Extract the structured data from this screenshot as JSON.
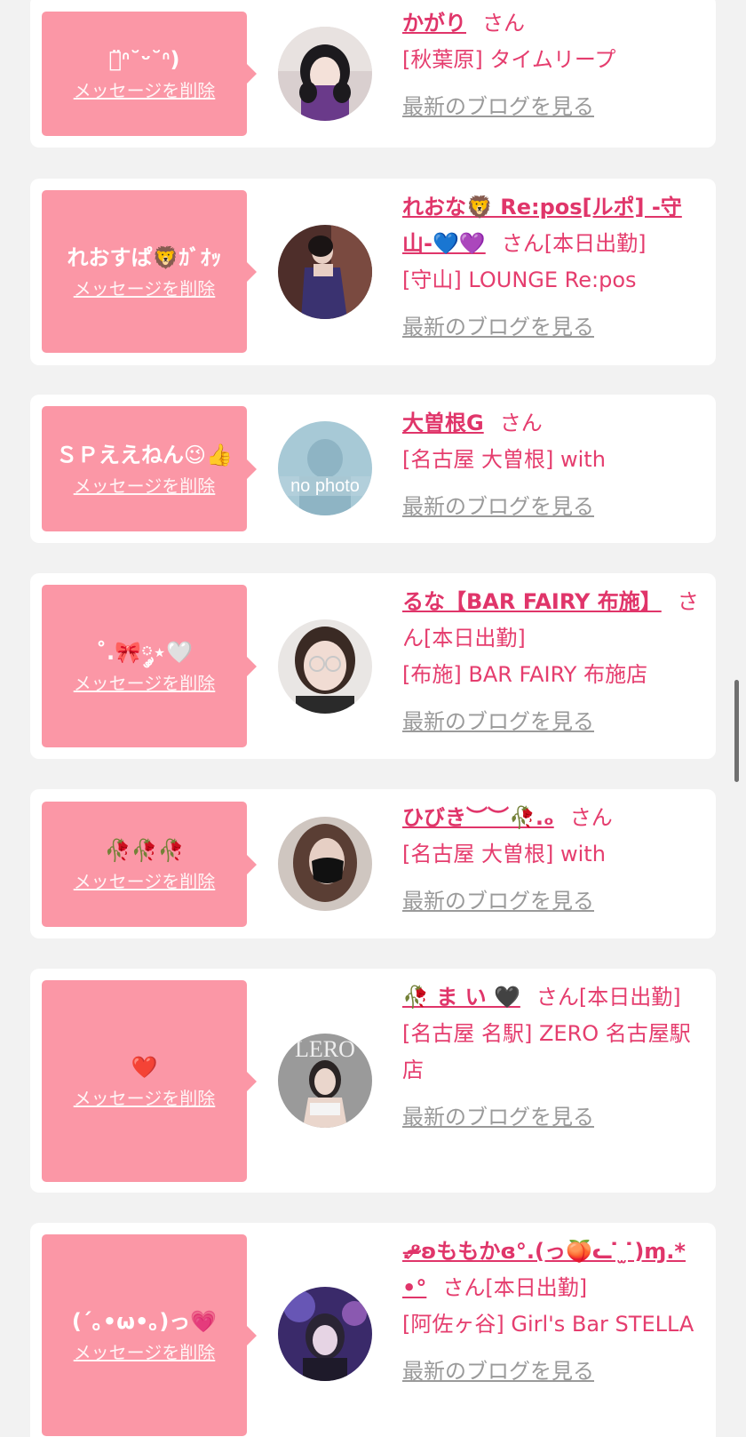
{
  "ui": {
    "delete_label": "メッセージを削除",
    "honorific": "さん",
    "blog_label": "最新のブログを見る"
  },
  "colors": {
    "page_bg": "#f2f2f2",
    "card_bg": "#ffffff",
    "bubble_bg": "#fb97a6",
    "name_text": "#e0356a",
    "info_text": "#e53d6e",
    "blog_link": "#9a9a9a"
  },
  "entries": [
    {
      "message": "ﾛ̈ᐢ˘ᵕ˘ᐢ)",
      "name": "かがり",
      "status": "",
      "shop": "[秋葉原] タイムリープ",
      "avatar": "photo-dark-hair-purple"
    },
    {
      "message": "れおすぱ🦁ｶﾞｵｯ",
      "name": "れおな🦁 Re:pos[ルポ] -守山-💙💜",
      "status": "[本日出勤]",
      "shop": "[守山] LOUNGE Re:pos",
      "avatar": "photo-dress-woman"
    },
    {
      "message": "ＳＰええねん😉👍",
      "name": "大曽根G",
      "status": "",
      "shop": "[名古屋 大曽根] with",
      "avatar": "no-photo"
    },
    {
      "message": "˚.🎀༘⋆🤍",
      "name": "るな【BAR FAIRY 布施】",
      "status": "[本日出勤]",
      "shop": "[布施] BAR FAIRY 布施店",
      "avatar": "photo-glasses"
    },
    {
      "message": "🥀🥀🥀",
      "name": "ひびき︶︶🥀.ₒ",
      "status": "",
      "shop": "[名古屋 大曽根] with",
      "avatar": "photo-mask"
    },
    {
      "message": "❤️",
      "name": "🥀 ま い 🖤",
      "status": "[本日出勤]",
      "shop": "[名古屋 名駅] ZERO 名古屋駅店",
      "avatar": "photo-zero-logo"
    },
    {
      "message": "(´｡•ω•｡)っ💗",
      "name": ".ᵒ̴̶̷ʚももかɞ°.(っ🍑ᓚ ̇ ̫ ̇)ɱ.*•°",
      "status": "[本日出勤]",
      "shop": "[阿佐ヶ谷] Girl's Bar STELLA",
      "avatar": "photo-purple-light"
    }
  ]
}
